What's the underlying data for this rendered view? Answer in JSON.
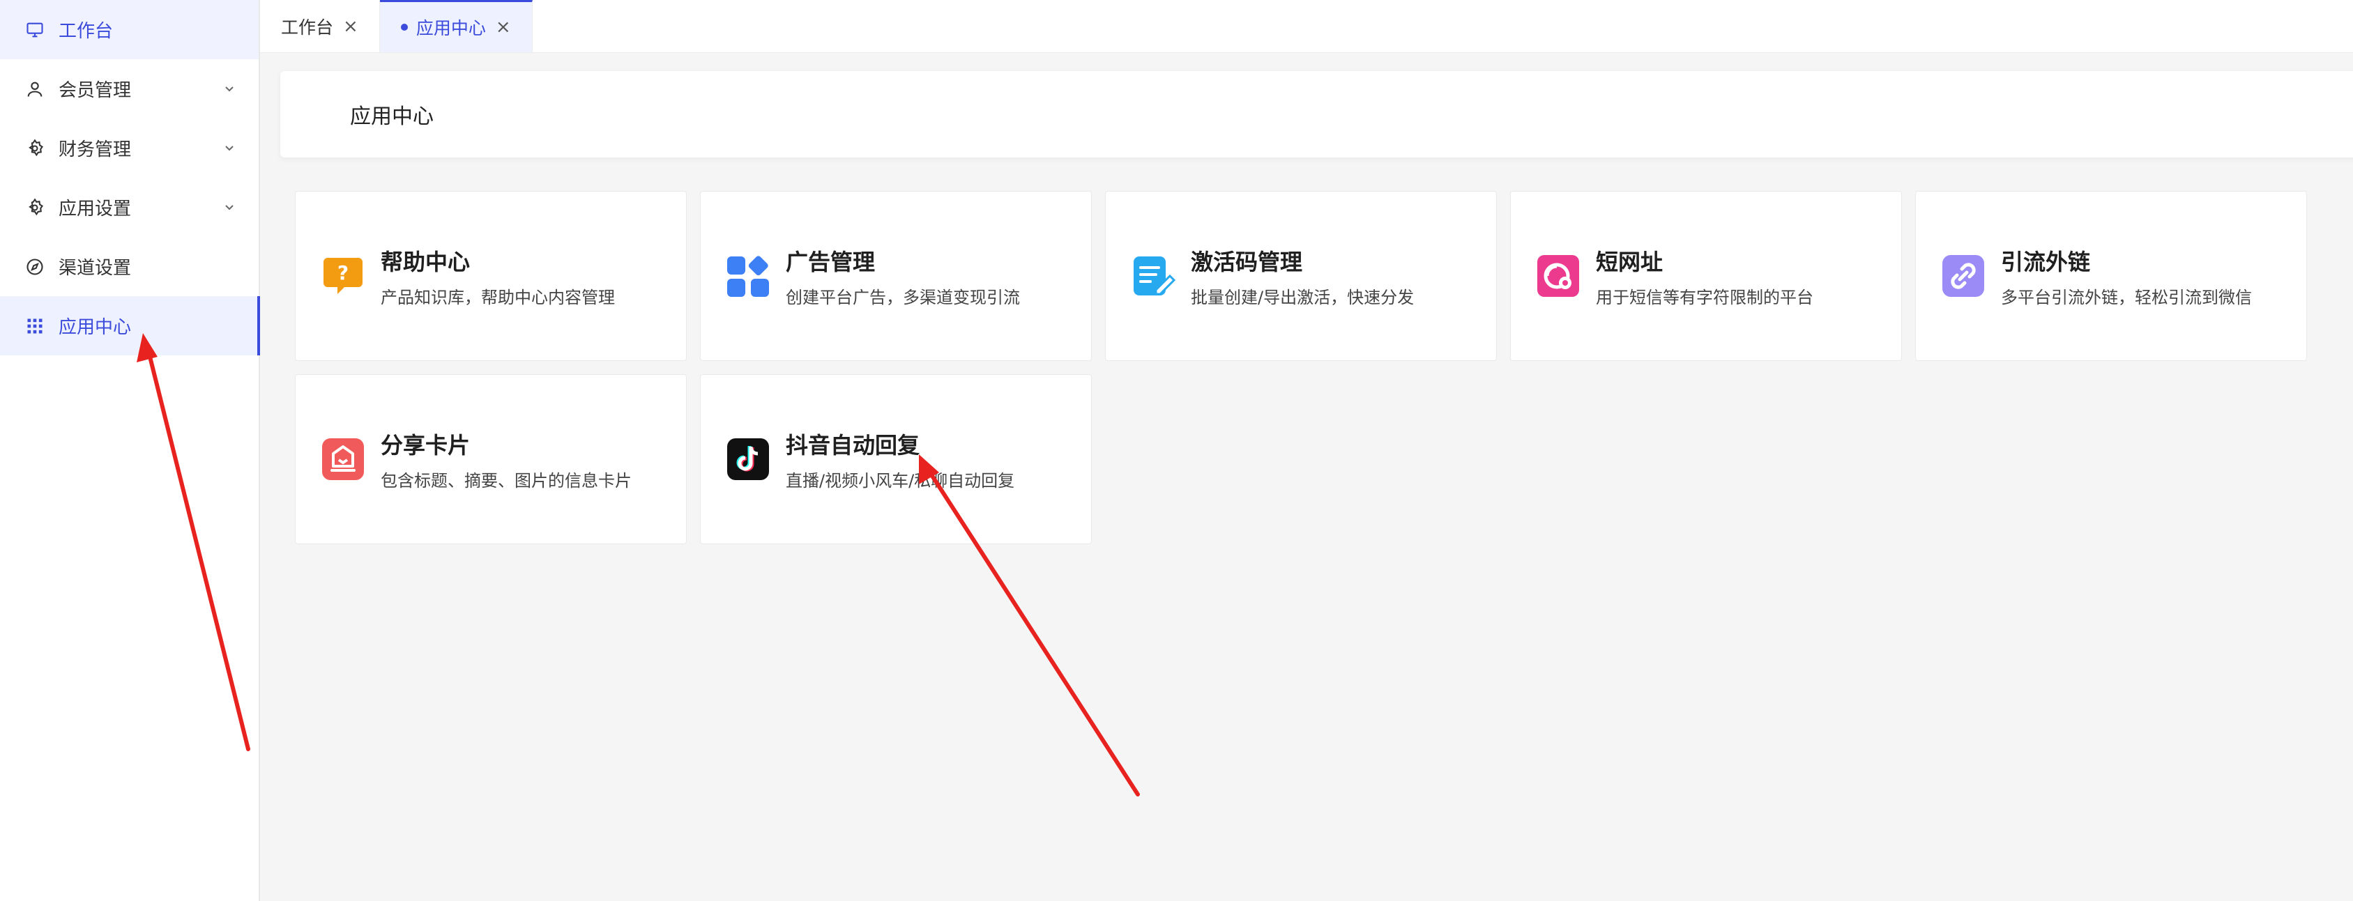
{
  "sidebar": {
    "items": [
      {
        "label": "工作台",
        "icon": "monitor-icon",
        "state": "active-top",
        "expandable": false
      },
      {
        "label": "会员管理",
        "icon": "user-icon",
        "state": "",
        "expandable": true
      },
      {
        "label": "财务管理",
        "icon": "gear-icon",
        "state": "",
        "expandable": true
      },
      {
        "label": "应用设置",
        "icon": "gear-icon",
        "state": "",
        "expandable": true
      },
      {
        "label": "渠道设置",
        "icon": "compass-icon",
        "state": "",
        "expandable": false
      },
      {
        "label": "应用中心",
        "icon": "grid-icon",
        "state": "active",
        "expandable": false
      }
    ]
  },
  "tabs": [
    {
      "label": "工作台",
      "active": false
    },
    {
      "label": "应用中心",
      "active": true
    }
  ],
  "header": {
    "title": "应用中心"
  },
  "apps": [
    {
      "title": "帮助中心",
      "desc": "产品知识库，帮助中心内容管理",
      "icon": "help-bubble-icon",
      "color": "#f39c12"
    },
    {
      "title": "广告管理",
      "desc": "创建平台广告，多渠道变现引流",
      "icon": "apps-blocks-icon",
      "color": "#3d7ff5"
    },
    {
      "title": "激活码管理",
      "desc": "批量创建/导出激活，快速分发",
      "icon": "edit-doc-icon",
      "color": "#27a9ef"
    },
    {
      "title": "短网址",
      "desc": "用于短信等有字符限制的平台",
      "icon": "link-gear-icon",
      "color": "#ec3a8f"
    },
    {
      "title": "引流外链",
      "desc": "多平台引流外链，轻松引流到微信",
      "icon": "chain-link-icon",
      "color": "#9b8bf7"
    },
    {
      "title": "分享卡片",
      "desc": "包含标题、摘要、图片的信息卡片",
      "icon": "share-card-icon",
      "color": "#f15a5a"
    },
    {
      "title": "抖音自动回复",
      "desc": "直播/视频小风车/私聊自动回复",
      "icon": "tiktok-icon",
      "color": "#111111"
    }
  ],
  "colors": {
    "accent": "#3b4bdb",
    "annotation_arrow": "#e8231f"
  }
}
